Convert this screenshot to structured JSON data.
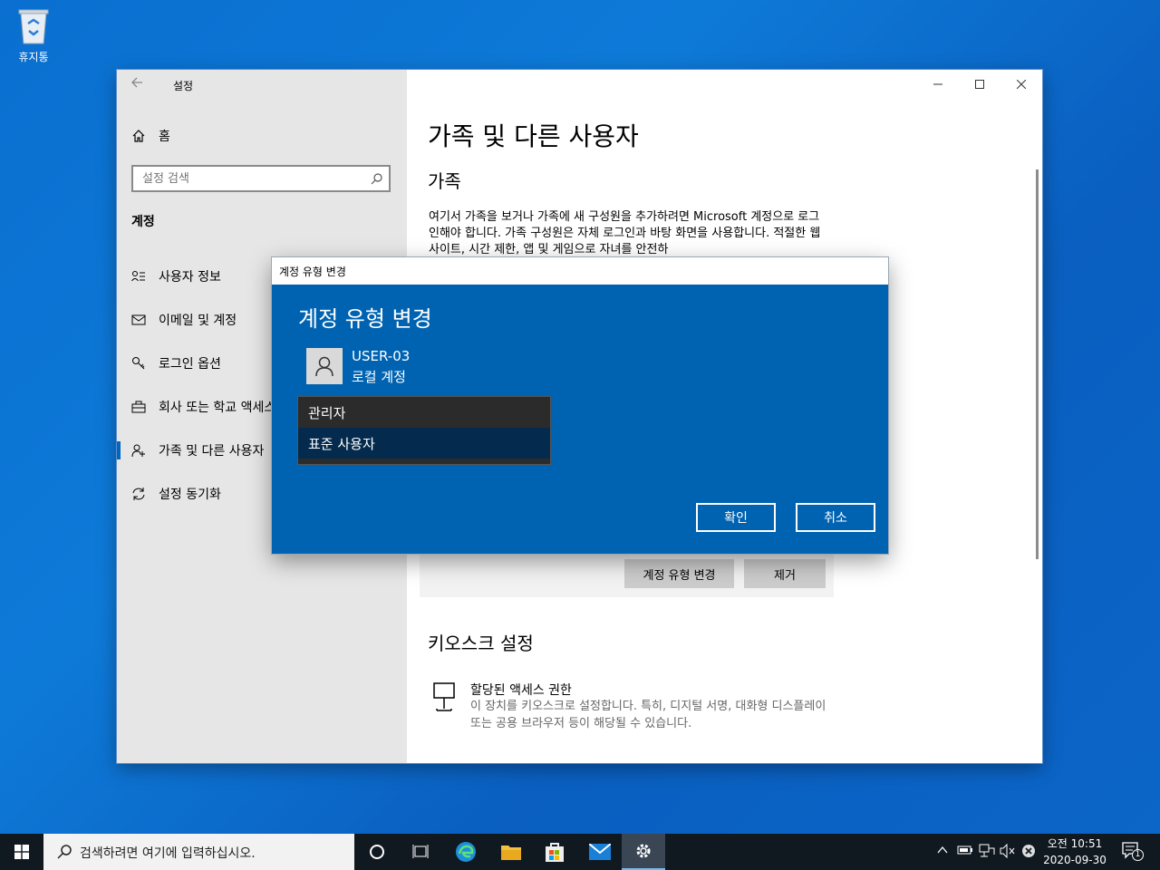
{
  "desktop": {
    "recycle_bin_label": "휴지통"
  },
  "window": {
    "title": "설정",
    "controls": [
      "minimize",
      "maximize",
      "close"
    ]
  },
  "sidebar": {
    "home_label": "홈",
    "search_placeholder": "설정 검색",
    "section_title": "계정",
    "items": [
      {
        "label": "사용자 정보",
        "icon": "user-info-icon"
      },
      {
        "label": "이메일 및 계정",
        "icon": "mail-icon"
      },
      {
        "label": "로그인 옵션",
        "icon": "key-icon"
      },
      {
        "label": "회사 또는 학교 액세스",
        "icon": "briefcase-icon"
      },
      {
        "label": "가족 및 다른 사용자",
        "icon": "person-add-icon",
        "active": true
      },
      {
        "label": "설정 동기화",
        "icon": "sync-icon"
      }
    ]
  },
  "main": {
    "title": "가족 및 다른 사용자",
    "family_header": "가족",
    "family_text": "여기서 가족을 보거나 가족에 새 구성원을 추가하려면 Microsoft 계정으로 로그인해야 합니다. 가족 구성원은 자체 로그인과 바탕 화면을 사용합니다. 적절한 웹 사이트, 시간 제한, 앱 및 게임으로 자녀를 안전하",
    "change_type_button": "계정 유형 변경",
    "remove_button": "제거",
    "kiosk_header": "키오스크 설정",
    "kiosk_title": "할당된 액세스 권한",
    "kiosk_desc": "이 장치를 키오스크로 설정합니다. 특히, 디지털 서명, 대화형 디스플레이 또는 공용 브라우저 등이 해당될 수 있습니다."
  },
  "dialog": {
    "window_title": "계정 유형 변경",
    "heading": "계정 유형 변경",
    "user_name": "USER-03",
    "user_type": "로컬 계정",
    "options": [
      "관리자",
      "표준 사용자"
    ],
    "selected_option": "표준 사용자",
    "ok_label": "확인",
    "cancel_label": "취소"
  },
  "taskbar": {
    "search_placeholder": "검색하려면 여기에 입력하십시오.",
    "time": "오전 10:51",
    "date": "2020-09-30",
    "notification_count": "1"
  }
}
